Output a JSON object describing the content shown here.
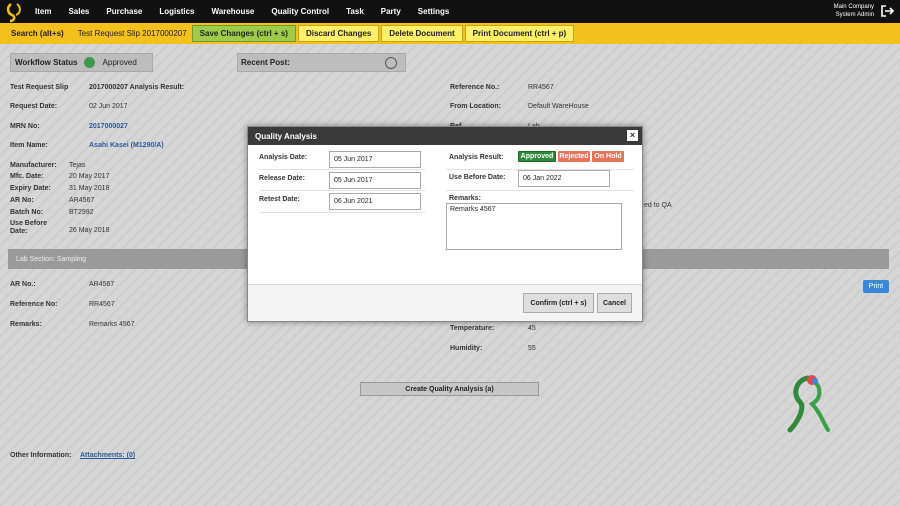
{
  "nav": {
    "items": [
      "Item",
      "Sales",
      "Purchase",
      "Logistics",
      "Warehouse",
      "Quality Control",
      "Task",
      "Party",
      "Settings"
    ],
    "company": "Main Company",
    "user": "System Admin"
  },
  "toolbar": {
    "search": "Search (alt+s)",
    "title": "Test Request Slip 2017000207",
    "save": "Save Changes (ctrl + s)",
    "discard": "Discard Changes",
    "delete": "Delete Document",
    "print": "Print Document (ctrl + p)"
  },
  "workflow": {
    "label": "Workflow Status",
    "status": "Approved"
  },
  "recent": {
    "label": "Recent Post:"
  },
  "slip": {
    "trs_label": "Test Request Slip",
    "trs_value": "2017000207 Analysis Result:",
    "request_date_label": "Request Date:",
    "request_date": "02 Jun 2017",
    "mrn_label": "MRN No:",
    "mrn": "2017000027",
    "item_label": "Item Name:",
    "item": "Asahi Kasei (M1290/A)",
    "manufacturer_label": "Manufacturer:",
    "manufacturer": "Tejas",
    "mfc_label": "Mfc. Date:",
    "mfc": "20 May 2017",
    "expiry_label": "Expiry Date:",
    "expiry": "31 May 2018",
    "ar_label": "AR No:",
    "ar": "AR4567",
    "batch_label": "Batch No:",
    "batch": "BT2992",
    "use_before_label": "Use Before Date:",
    "use_before": "26 May 2018",
    "ref_label": "Reference No.:",
    "ref": "RR4567",
    "from_label": "From Location:",
    "from": "Default WareHouse",
    "partial_r1": "Ref",
    "partial_v1": "Lab",
    "partial_qa": "ed to QA"
  },
  "lab": {
    "section": "Lab Section: Sampling",
    "ar_label": "AR No.:",
    "ar": "AR4567",
    "ref_label": "Reference No:",
    "ref": "RR4567",
    "remarks_label": "Remarks:",
    "remarks": "Remarks 4567",
    "temp_label": "Temperature:",
    "temp": "45",
    "hum_label": "Humidity:",
    "hum": "55",
    "print": "Print",
    "create": "Create Quality Analysis (a)"
  },
  "other": {
    "label": "Other Information:",
    "attachments": "Attachments: (0)"
  },
  "modal": {
    "title": "Quality Analysis",
    "close": "×",
    "analysis_date_label": "Analysis Date:",
    "analysis_date": "05 Jun 2017",
    "release_date_label": "Release Date:",
    "release_date": "05 Jun 2017",
    "retest_date_label": "Retest Date:",
    "retest_date": "06 Jun 2021",
    "result_label": "Analysis Result:",
    "approved": "Approved",
    "rejected": "Rejected",
    "on_hold": "On Hold",
    "use_before_label": "Use Before Date:",
    "use_before": "06 Jan 2022",
    "remarks_label": "Remarks:",
    "remarks": "Remarks 4567",
    "confirm": "Confirm (ctrl + s)",
    "cancel": "Cancel"
  },
  "colors": {
    "nav_bg": "#111111",
    "toolbar_bg": "#f4c01e",
    "approved": "#2e8b3a",
    "rejected": "#e8735a",
    "on_hold": "#e8735a",
    "print_btn": "#3a86d8"
  }
}
